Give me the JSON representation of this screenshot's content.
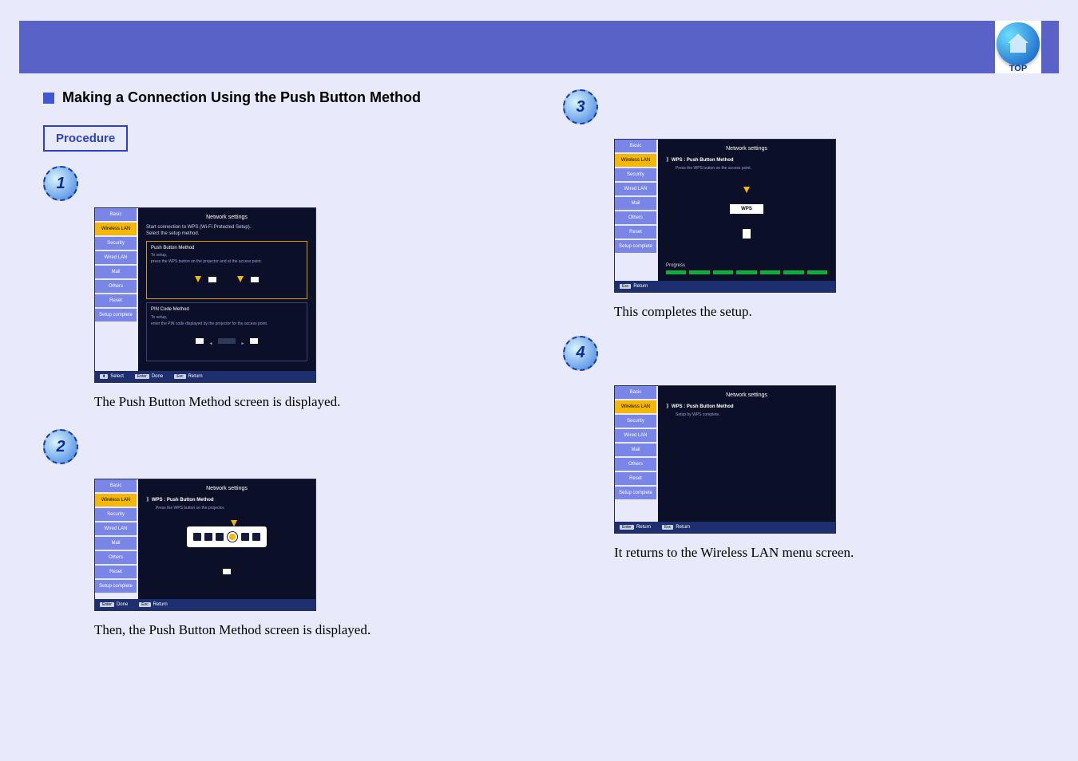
{
  "header": {
    "top_label": "TOP"
  },
  "title": "Making a Connection Using the Push Button Method",
  "procedure_label": "Procedure",
  "steps": {
    "s1": {
      "num": "1",
      "caption": "The Push Button Method screen is displayed."
    },
    "s2": {
      "num": "2",
      "caption": "Then, the Push Button Method screen is displayed."
    },
    "s3": {
      "num": "3",
      "caption": "This completes the setup."
    },
    "s4": {
      "num": "4",
      "caption": "It returns to the Wireless LAN menu screen."
    }
  },
  "side_tabs": {
    "basic": "Basic",
    "wlan": "Wireless LAN",
    "security": "Security",
    "wiredlan": "Wired LAN",
    "mail": "Mail",
    "others": "Others",
    "reset": "Reset",
    "complete": "Setup complete"
  },
  "screen1": {
    "title": "Network settings",
    "intro1": "Start connection to WPS (Wi-Fi Protected Setup).",
    "intro2": "Select the setup method.",
    "box1_title": "Push Button Method",
    "box1_line1": "To setup,",
    "box1_line2": "press the WPS button on the projector and at the access point.",
    "box2_title": "PIN Code Method",
    "box2_line1": "To setup,",
    "box2_line2": "enter the PIN code displayed by the projector for the access point.",
    "footer": {
      "select": "Select",
      "done": "Done",
      "return": "Return"
    }
  },
  "screen2": {
    "title": "Network settings",
    "heading": "WPS : Push Button Method",
    "line": "Press the WPS button on the projector.",
    "footer": {
      "done": "Done",
      "return": "Return"
    }
  },
  "screen3": {
    "title": "Network settings",
    "heading": "WPS : Push Button Method",
    "line": "Press the WPS button on the access point.",
    "btn": "WPS",
    "progress": "Progress",
    "footer": {
      "return": "Return"
    }
  },
  "screen4": {
    "title": "Network settings",
    "heading": "WPS : Push Button Method",
    "line": "Setup by WPS complete.",
    "footer": {
      "return1": "Return",
      "return2": "Return"
    }
  },
  "footer_keys": {
    "arrows": "⬍",
    "enter": "Enter",
    "esc": "Esc"
  }
}
